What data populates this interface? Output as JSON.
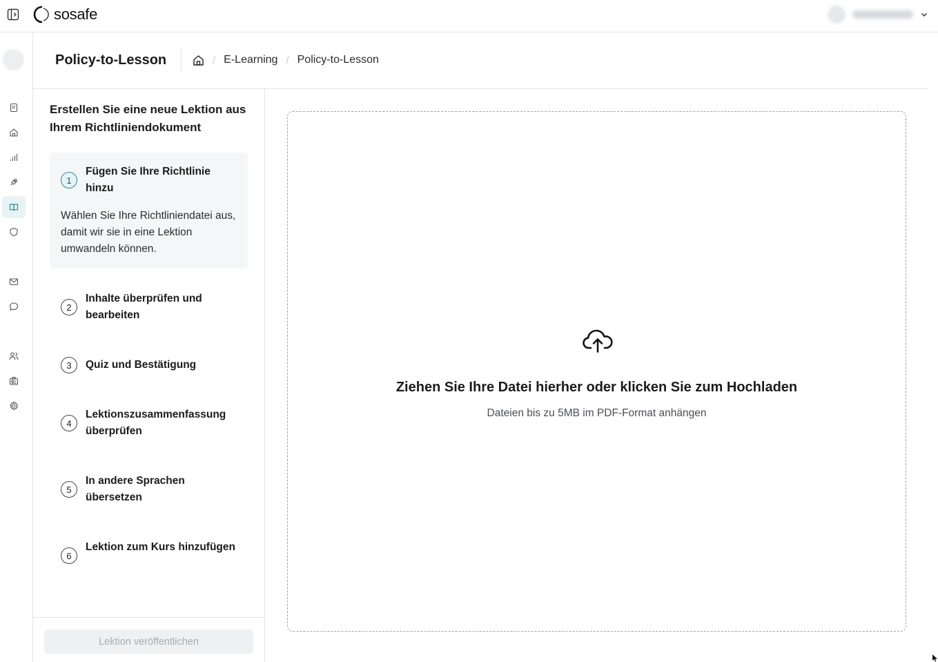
{
  "brand": {
    "name": "sosafe"
  },
  "header": {
    "title": "Policy-to-Lesson",
    "breadcrumb": [
      {
        "label": "E-Learning"
      },
      {
        "label": "Policy-to-Lesson"
      }
    ]
  },
  "rail": {
    "items": [
      {
        "icon": "clipboard-icon"
      },
      {
        "icon": "home-icon"
      },
      {
        "icon": "chart-icon"
      },
      {
        "icon": "rocket-icon"
      },
      {
        "icon": "book-icon",
        "active": true
      },
      {
        "icon": "shield-icon"
      },
      {
        "icon": "mail-icon"
      },
      {
        "icon": "chat-icon"
      },
      {
        "icon": "users-icon"
      },
      {
        "icon": "id-badge-icon"
      },
      {
        "icon": "gear-icon"
      }
    ]
  },
  "steps": {
    "heading": "Erstellen Sie eine neue Lektion aus Ihrem Richtliniendokument",
    "items": [
      {
        "num": "1",
        "title": "Fügen Sie Ihre Richtlinie hinzu",
        "description": "Wählen Sie Ihre Richtliniendatei aus, damit wir sie in eine Lektion umwandeln können."
      },
      {
        "num": "2",
        "title": "Inhalte überprüfen und bearbeiten"
      },
      {
        "num": "3",
        "title": "Quiz und Bestätigung"
      },
      {
        "num": "4",
        "title": "Lektionszusammenfassung überprüfen"
      },
      {
        "num": "5",
        "title": "In andere Sprachen übersetzen"
      },
      {
        "num": "6",
        "title": "Lektion zum Kurs hinzufügen"
      }
    ],
    "publish_label": "Lektion veröffentlichen"
  },
  "upload": {
    "title": "Ziehen Sie Ihre Datei hierher oder klicken Sie zum Hochladen",
    "subtitle": "Dateien bis zu 5MB im PDF-Format anhängen"
  },
  "colors": {
    "accent": "#2b8a9c",
    "active_bg": "#e8f3f5",
    "border": "#e3e5e8"
  }
}
